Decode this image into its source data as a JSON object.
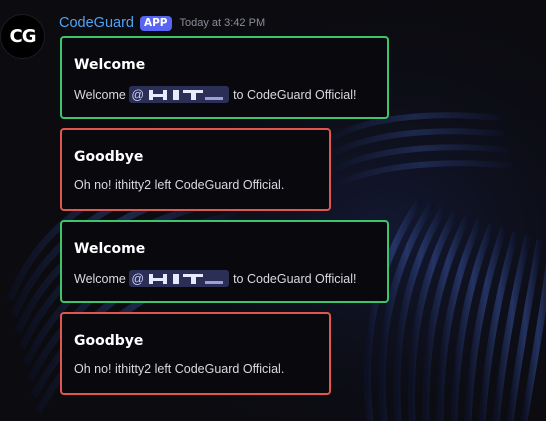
{
  "bot": {
    "avatar_text": "CG",
    "username": "CodeGuard",
    "badge": "APP",
    "timestamp": "Today at 3:42 PM"
  },
  "messages": [
    {
      "type": "welcome",
      "title": "Welcome",
      "prefix": "Welcome",
      "mention_at": "@",
      "suffix": "to CodeGuard Official!"
    },
    {
      "type": "goodbye",
      "title": "Goodbye",
      "text": "Oh no! ithitty2 left CodeGuard Official."
    },
    {
      "type": "welcome",
      "title": "Welcome",
      "prefix": "Welcome",
      "mention_at": "@",
      "suffix": "to CodeGuard Official!"
    },
    {
      "type": "goodbye",
      "title": "Goodbye",
      "text": "Oh no! ithitty2 left CodeGuard Official."
    }
  ],
  "colors": {
    "welcome_border": "#3ec46d",
    "goodbye_border": "#e0574f",
    "username": "#4fa3f5",
    "badge": "#5865f2",
    "mention_bg": "#2b2f55"
  }
}
